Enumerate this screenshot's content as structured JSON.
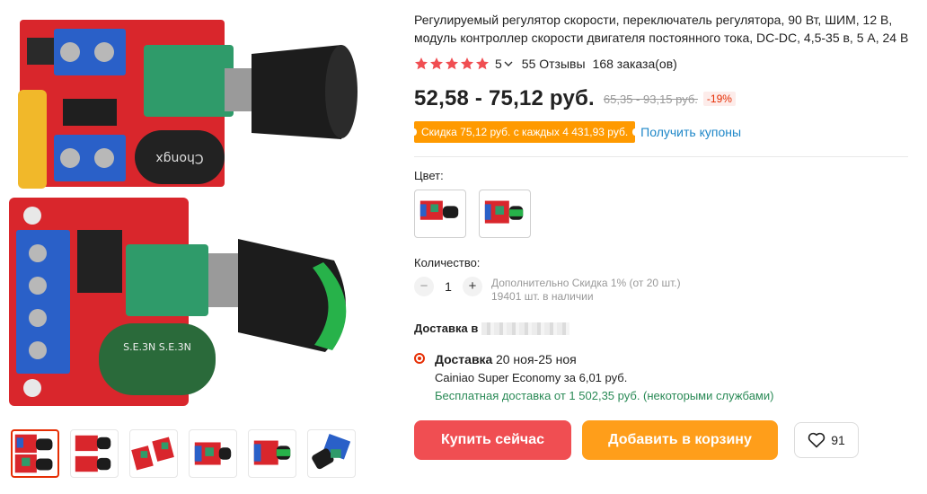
{
  "product": {
    "title": "Регулируемый регулятор скорости, переключатель регулятора, 90 Вт, ШИМ, 12 В, модуль контроллер скорости двигателя постоянного тока, DC-DC, 4,5-35 в, 5 А, 24 В",
    "rating": "5",
    "star_count": 5,
    "reviews": "55 Отзывы",
    "orders": "168 заказа(ов)"
  },
  "price": {
    "current": "52,58 - 75,12 руб.",
    "old": "65,35 - 93,15 руб.",
    "discount": "-19%"
  },
  "coupon": {
    "badge": "Скидка 75,12 руб. с каждых 4 431,93 руб.",
    "link": "Получить купоны"
  },
  "color": {
    "label": "Цвет:",
    "options": [
      "color-option-1",
      "color-option-2"
    ]
  },
  "quantity": {
    "label": "Количество:",
    "minus": "−",
    "value": "1",
    "plus": "+",
    "discount_note": "Дополнительно Скидка 1% (от 20 шт.)",
    "stock": "19401 шт. в наличии"
  },
  "delivery": {
    "title": "Доставка в",
    "method_label": "Доставка",
    "dates": "20 ноя-25 ноя",
    "carrier": "Cainiao Super Economy за 6,01 руб.",
    "free": "Бесплатная доставка от 1 502,35 руб. (некоторыми службами)"
  },
  "actions": {
    "buy": "Купить сейчас",
    "cart": "Добавить в корзину",
    "wishlist_count": "91"
  },
  "gallery": {
    "thumb_count": 6,
    "active_index": 0
  },
  "colors": {
    "accent": "#e62e04",
    "buy_button": "#f04e52",
    "cart_button": "#ff9e1a",
    "coupon": "#ff9a00",
    "link": "#1e87c8",
    "free_shipping": "#2a8a56",
    "star": "#f04e52"
  },
  "icons": {
    "star": "star-icon",
    "chevron": "chevron-down-icon",
    "heart": "heart-icon",
    "radio": "radio-selected-icon"
  }
}
